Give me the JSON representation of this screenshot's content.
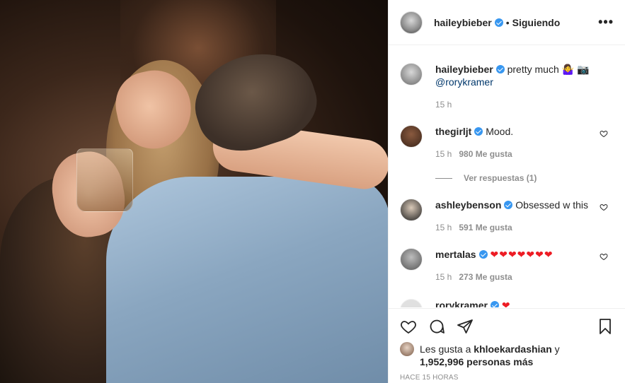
{
  "post": {
    "username": "haileybieber",
    "separator": "•",
    "follow_status": "Siguiendo",
    "more_label": "•••"
  },
  "caption": {
    "username": "haileybieber",
    "text": "pretty much 🤷‍♀️ 📷",
    "mention": "@rorykramer",
    "time": "15 h"
  },
  "comments": [
    {
      "username": "thegirljt",
      "text": "Mood.",
      "time": "15 h",
      "likes": "980 Me gusta",
      "replies": "Ver respuestas (1)",
      "avatar_color": "#3a2418"
    },
    {
      "username": "ashleybenson",
      "text": "Obsessed w this",
      "time": "15 h",
      "likes": "591 Me gusta",
      "avatar_color": "#2b2b2b"
    },
    {
      "username": "mertalas",
      "text": "❤❤❤❤❤❤❤",
      "time": "15 h",
      "likes": "273 Me gusta",
      "avatar_color": "#7a7a7a"
    },
    {
      "username": "rorykramer",
      "text": "❤",
      "avatar_color": "#cccccc"
    }
  ],
  "actions": {
    "like_icon": "heart-icon",
    "comment_icon": "comment-icon",
    "share_icon": "share-icon",
    "save_icon": "bookmark-icon"
  },
  "likes": {
    "prefix": "Les gusta a",
    "user": "khloekardashian",
    "joiner": "y",
    "count": "1,952,996 personas más"
  },
  "timestamp": "HACE 15 HORAS",
  "colors": {
    "verified": "#3897f0",
    "link": "#00376b",
    "muted": "#8e8e8e",
    "heart": "#ed1c24"
  }
}
